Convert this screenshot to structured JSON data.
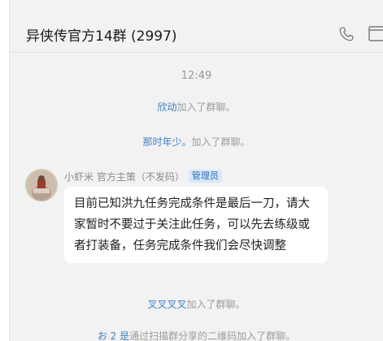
{
  "chat": {
    "title": "异侠传官方14群 (2997)"
  },
  "header_icons": [
    "phone-icon",
    "screen-share-icon"
  ],
  "messages": {
    "time": "12:49",
    "sys1": {
      "who": "欣动",
      "text": "加入了群聊。"
    },
    "sys2": {
      "who": "那时年少。",
      "text": "加入了群聊。"
    },
    "post": {
      "sender": "小虾米 官方主策（不发码）",
      "badge": "管理员",
      "text": "目前已知洪九任务完成条件是最后一刀，请大家暂时不要过于关注此任务，可以先去练级或者打装备，任务完成条件我们会尽快调整"
    },
    "sys3": {
      "who": "叉叉叉叉",
      "text": "加入了群聊。"
    },
    "sys4": {
      "who": "お 2 是",
      "text": "通过扫描群分享的二维码加入了群聊。"
    }
  },
  "colors": {
    "link": "#3e7fc4",
    "system_text": "#9b9b9b",
    "badge_bg": "#d8e8f8",
    "badge_text": "#2f6fb8",
    "bubble_bg": "#ffffff",
    "background": "#f2f2f2"
  }
}
